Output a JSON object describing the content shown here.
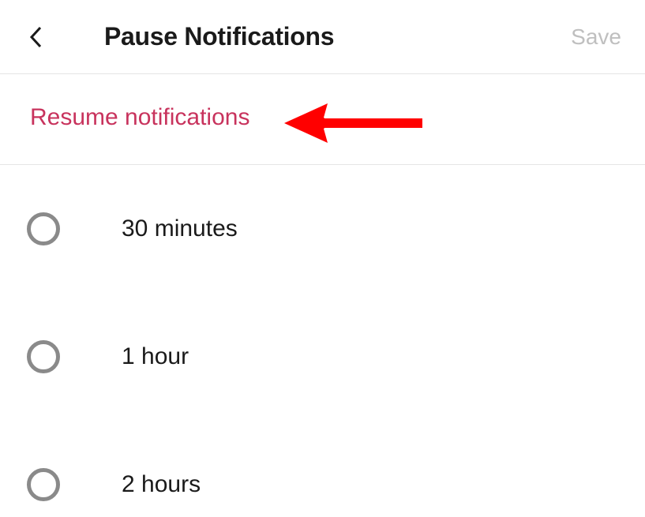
{
  "header": {
    "title": "Pause Notifications",
    "save_label": "Save"
  },
  "resume": {
    "label": "Resume notifications"
  },
  "options": [
    {
      "label": "30 minutes"
    },
    {
      "label": "1 hour"
    },
    {
      "label": "2 hours"
    }
  ]
}
